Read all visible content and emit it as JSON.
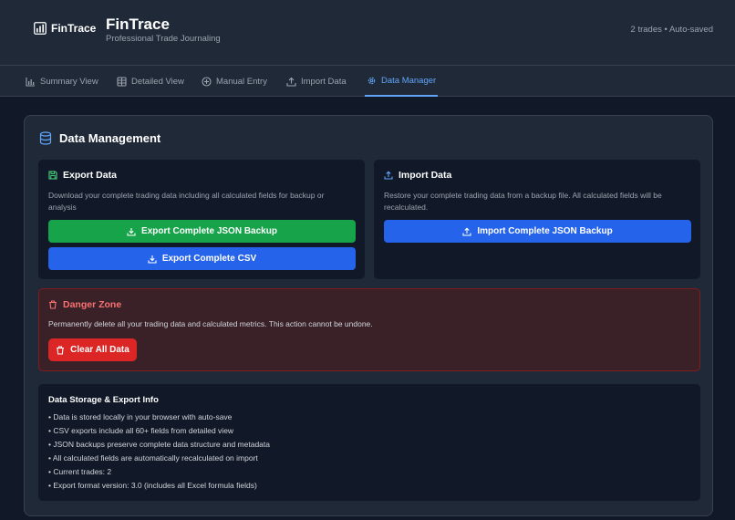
{
  "header": {
    "logo_text": "FinTrace",
    "title": "FinTrace",
    "subtitle": "Professional Trade Journaling",
    "status": "2 trades • Auto-saved"
  },
  "tabs": [
    {
      "label": "Summary View",
      "icon": "bar-chart-icon"
    },
    {
      "label": "Detailed View",
      "icon": "table-icon"
    },
    {
      "label": "Manual Entry",
      "icon": "plus-circle-icon"
    },
    {
      "label": "Import Data",
      "icon": "upload-icon"
    },
    {
      "label": "Data Manager",
      "icon": "gear-icon",
      "active": true
    }
  ],
  "panel": {
    "title": "Data Management",
    "export": {
      "title": "Export Data",
      "description": "Download your complete trading data including all calculated fields for backup or analysis",
      "json_button": "Export Complete JSON Backup",
      "csv_button": "Export Complete CSV"
    },
    "import": {
      "title": "Import Data",
      "description": "Restore your complete trading data from a backup file. All calculated fields will be recalculated.",
      "json_button": "Import Complete JSON Backup"
    },
    "danger": {
      "title": "Danger Zone",
      "description": "Permanently delete all your trading data and calculated metrics. This action cannot be undone.",
      "clear_button": "Clear All Data"
    },
    "info": {
      "title": "Data Storage & Export Info",
      "items": [
        "• Data is stored locally in your browser with auto-save",
        "• CSV exports include all 60+ fields from detailed view",
        "• JSON backups preserve complete data structure and metadata",
        "• All calculated fields are automatically recalculated on import",
        "• Current trades: 2",
        "• Export format version: 3.0 (includes all Excel formula fields)"
      ]
    }
  },
  "colors": {
    "background": "#111827",
    "surface": "#1f2937",
    "accent": "#60a5fa",
    "green": "#16a34a",
    "blue": "#2563eb",
    "red": "#dc2626"
  }
}
